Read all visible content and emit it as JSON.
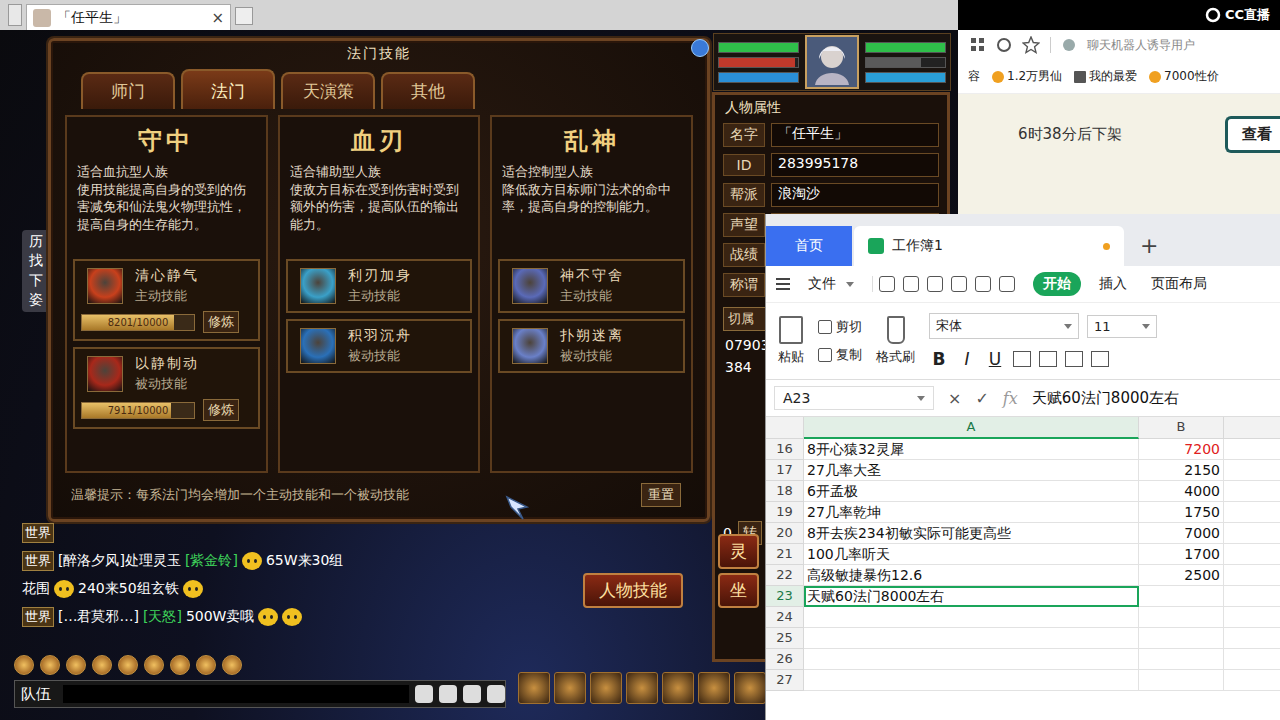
{
  "game": {
    "window_tab": {
      "title": "「任平生」",
      "close": "×"
    },
    "side_strip": [
      "历",
      "找",
      "下",
      "姿"
    ],
    "dialog": {
      "title": "法门技能",
      "tabs": [
        {
          "label": "师门",
          "selected": false
        },
        {
          "label": "法门",
          "selected": true
        },
        {
          "label": "天演策",
          "selected": false
        },
        {
          "label": "其他",
          "selected": false
        }
      ],
      "schools": [
        {
          "name": "守中",
          "desc": "适合血抗型人族\n使用技能提高自身的受到的伤害减免和仙法鬼火物理抗性，提高自身的生存能力。",
          "skills": [
            {
              "name": "清心静气",
              "type": "主动技能",
              "kind": "learned",
              "level": 0.8201,
              "reading": "8201/10000",
              "button": "修炼",
              "color": "#c8401c"
            },
            {
              "name": "以静制动",
              "type": "被动技能",
              "kind": "learned",
              "level": 0.7911,
              "reading": "7911/10000",
              "button": "修炼",
              "color": "#a8281a"
            }
          ]
        },
        {
          "name": "血刃",
          "desc": "适合辅助型人族\n使敌方目标在受到伤害时受到额外的伤害，提高队伍的输出能力。",
          "skills": [
            {
              "name": "利刃加身",
              "type": "主动技能",
              "kind": "locked",
              "color": "#3aa0c8"
            },
            {
              "name": "积羽沉舟",
              "type": "被动技能",
              "kind": "locked",
              "color": "#2a70b8"
            }
          ]
        },
        {
          "name": "乱神",
          "desc": "适合控制型人族\n降低敌方目标师门法术的命中率，提高自身的控制能力。",
          "skills": [
            {
              "name": "神不守舍",
              "type": "主动技能",
              "kind": "locked",
              "color": "#5a6ab8"
            },
            {
              "name": "扑朔迷离",
              "type": "被动技能",
              "kind": "locked",
              "color": "#6a80c8"
            }
          ]
        }
      ],
      "tip": "温馨提示：每系法门均会增加一个主动技能和一个被动技能",
      "reset": "重置"
    },
    "portrait": {
      "left_bars": [
        {
          "level": 1,
          "color": "#2fbf4a"
        },
        {
          "level": 0.96,
          "color": "#c0392b"
        },
        {
          "level": 1,
          "color": "#2a8fd8"
        }
      ],
      "right_bars": [
        {
          "level": 1,
          "color": "#2fbf4a"
        },
        {
          "level": 0.7,
          "color": "#5a5a5a"
        },
        {
          "level": 1,
          "color": "#2a9fd8"
        }
      ]
    },
    "attributes": {
      "title": "人物属性",
      "fields": [
        {
          "label": "名字",
          "value": "「任平生」"
        },
        {
          "label": "ID",
          "value": "283995178"
        },
        {
          "label": "帮派",
          "value": "浪淘沙"
        },
        {
          "label": "声望"
        },
        {
          "label": "战绩"
        },
        {
          "label": "称谓"
        }
      ],
      "switch": "切属",
      "numbers": [
        "07903",
        "384"
      ],
      "bottom_number": "0",
      "turn": "转"
    },
    "chat": [
      {
        "channel": "世界",
        "parts": []
      },
      {
        "channel": "世界",
        "parts": [
          {
            "kind": "text",
            "text": "[醉洛夕风]处理灵玉",
            "color": "#ffffff"
          },
          {
            "kind": "text",
            "text": "[紫金铃]",
            "color": "#3ed35a"
          },
          {
            "kind": "emoji"
          },
          {
            "kind": "text",
            "text": "65W来30组",
            "color": "#ffffff"
          }
        ]
      },
      {
        "channel": "",
        "parts": [
          {
            "kind": "text",
            "text": "花围",
            "color": "#ffffff"
          },
          {
            "kind": "emoji"
          },
          {
            "kind": "text",
            "text": "240来50组玄铁",
            "color": "#ffffff"
          },
          {
            "kind": "emoji"
          }
        ]
      },
      {
        "channel": "世界",
        "parts": [
          {
            "kind": "text",
            "text": "[…君莫邪…]",
            "color": "#ffffff"
          },
          {
            "kind": "text",
            "text": "[天怒]",
            "color": "#3ed35a"
          },
          {
            "kind": "text",
            "text": "500W卖哦",
            "color": "#ffffff"
          },
          {
            "kind": "emoji"
          },
          {
            "kind": "emoji"
          }
        ]
      }
    ],
    "action_buttons": [
      "人物技能",
      "灵",
      "坐"
    ],
    "team": "队伍"
  },
  "browser": {
    "logo": "CC直播",
    "address": "聊天机器人诱导用户",
    "bookmarks": [
      "容",
      "1.2万男仙",
      "我的最爱",
      "7000性价"
    ],
    "notice": "6时38分后下架",
    "button": "查看"
  },
  "sheet": {
    "tabs": [
      {
        "label": "首页",
        "kind": "home",
        "selected": false,
        "unsaved": false
      },
      {
        "label": "工作簿1",
        "kind": "book",
        "selected": true,
        "unsaved": true
      }
    ],
    "new_tab": "+",
    "menu": [
      {
        "label": "文件",
        "selected": false
      },
      {
        "label": "开始",
        "selected": true
      },
      {
        "label": "插入",
        "selected": false
      },
      {
        "label": "页面布局",
        "selected": false
      }
    ],
    "clip_tools": [
      {
        "label": "剪切"
      },
      {
        "label": "复制"
      }
    ],
    "paste": "粘贴",
    "brush": "格式刷",
    "font": "宋体",
    "size": "11",
    "format_buttons": [
      "B",
      "I",
      "U"
    ],
    "cell_ref": "A23",
    "formula_marks": [
      "×",
      "✓",
      "fx"
    ],
    "formula": "天赋60法门8000左右",
    "columns": [
      {
        "label": "A",
        "selected": true
      },
      {
        "label": "B",
        "selected": false
      }
    ],
    "rows": [
      {
        "num": "16",
        "a": "8开心猿32灵犀",
        "b": "7200",
        "highlight": true,
        "selected": false
      },
      {
        "num": "17",
        "a": "27几率大圣",
        "b": "2150",
        "highlight": false,
        "selected": false
      },
      {
        "num": "18",
        "a": "6开孟极",
        "b": "4000",
        "highlight": false,
        "selected": false
      },
      {
        "num": "19",
        "a": "27几率乾坤",
        "b": "1750",
        "highlight": false,
        "selected": false
      },
      {
        "num": "20",
        "a": "8开去疾234初敏实际可能更高些",
        "b": "7000",
        "highlight": false,
        "selected": false
      },
      {
        "num": "21",
        "a": "100几率听天",
        "b": "1700",
        "highlight": false,
        "selected": false
      },
      {
        "num": "22",
        "a": "高级敏捷暴伤12.6",
        "b": "2500",
        "highlight": false,
        "selected": false
      },
      {
        "num": "23",
        "a": "天赋60法门8000左右",
        "b": "",
        "highlight": false,
        "selected": true
      },
      {
        "num": "24",
        "a": "",
        "b": "",
        "highlight": false,
        "selected": false
      },
      {
        "num": "25",
        "a": "",
        "b": "",
        "highlight": false,
        "selected": false
      },
      {
        "num": "26",
        "a": "",
        "b": "",
        "highlight": false,
        "selected": false
      },
      {
        "num": "27",
        "a": "",
        "b": "",
        "highlight": false,
        "selected": false
      }
    ]
  }
}
